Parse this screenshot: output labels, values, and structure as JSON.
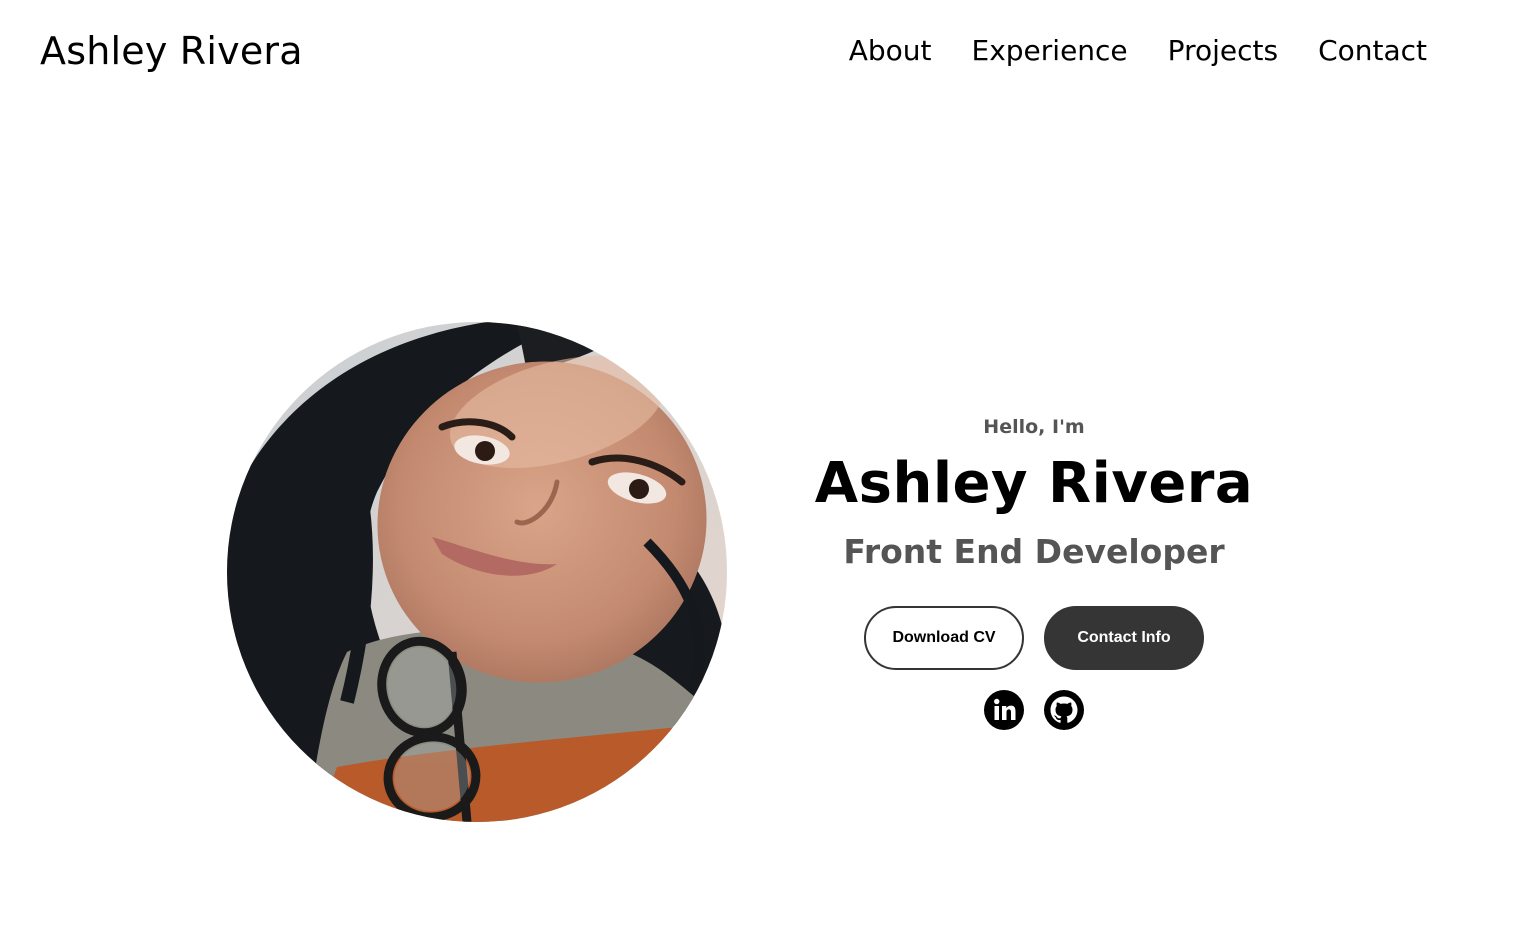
{
  "nav": {
    "logo": "Ashley Rivera",
    "links": [
      {
        "label": "About"
      },
      {
        "label": "Experience"
      },
      {
        "label": "Projects"
      },
      {
        "label": "Contact"
      }
    ]
  },
  "hero": {
    "greeting": "Hello, I'm",
    "name": "Ashley Rivera",
    "role": "Front End Developer",
    "buttons": {
      "download_cv": "Download CV",
      "contact_info": "Contact Info"
    },
    "socials": [
      {
        "icon": "linkedin-icon"
      },
      {
        "icon": "github-icon"
      }
    ],
    "profile_picture": {
      "icon": "profile-photo"
    }
  },
  "colors": {
    "text": "#000000",
    "muted_text": "#555555",
    "button_dark": "#353535",
    "background": "#ffffff"
  }
}
